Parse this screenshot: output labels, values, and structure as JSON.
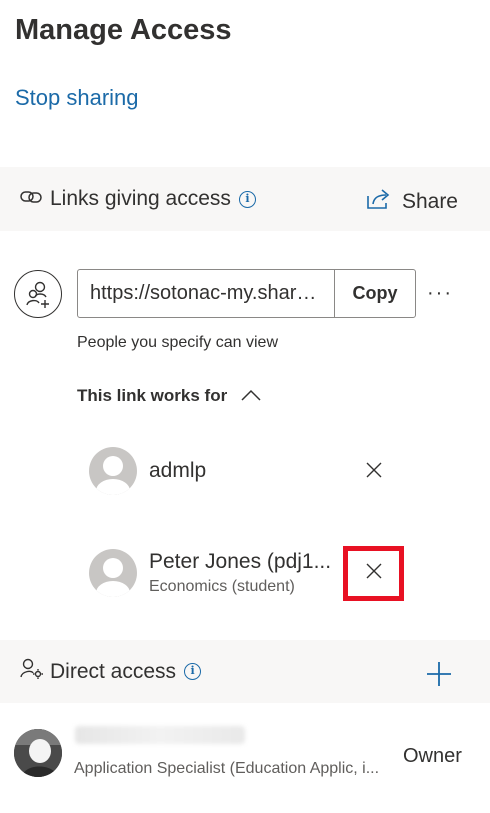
{
  "header": {
    "title": "Manage Access",
    "stop_sharing": "Stop sharing"
  },
  "links_section": {
    "title": "Links giving access",
    "info_icon": "i",
    "share_label": "Share"
  },
  "link": {
    "url": "https://sotonac-my.sharepoint.com/",
    "copy_label": "Copy",
    "more_label": "···",
    "description": "People you specify can view",
    "works_for_label": "This link works for"
  },
  "people": [
    {
      "name": "admlp",
      "detail": ""
    },
    {
      "name": "Peter Jones (pdj1...",
      "detail": "Economics (student)"
    }
  ],
  "direct_section": {
    "title": "Direct access",
    "info_icon": "i"
  },
  "owner": {
    "detail": "Application Specialist (Education Applic, i...",
    "role": "Owner"
  },
  "colors": {
    "link": "#1b6aa8",
    "highlight": "#e81123",
    "band": "#f8f7f6"
  }
}
